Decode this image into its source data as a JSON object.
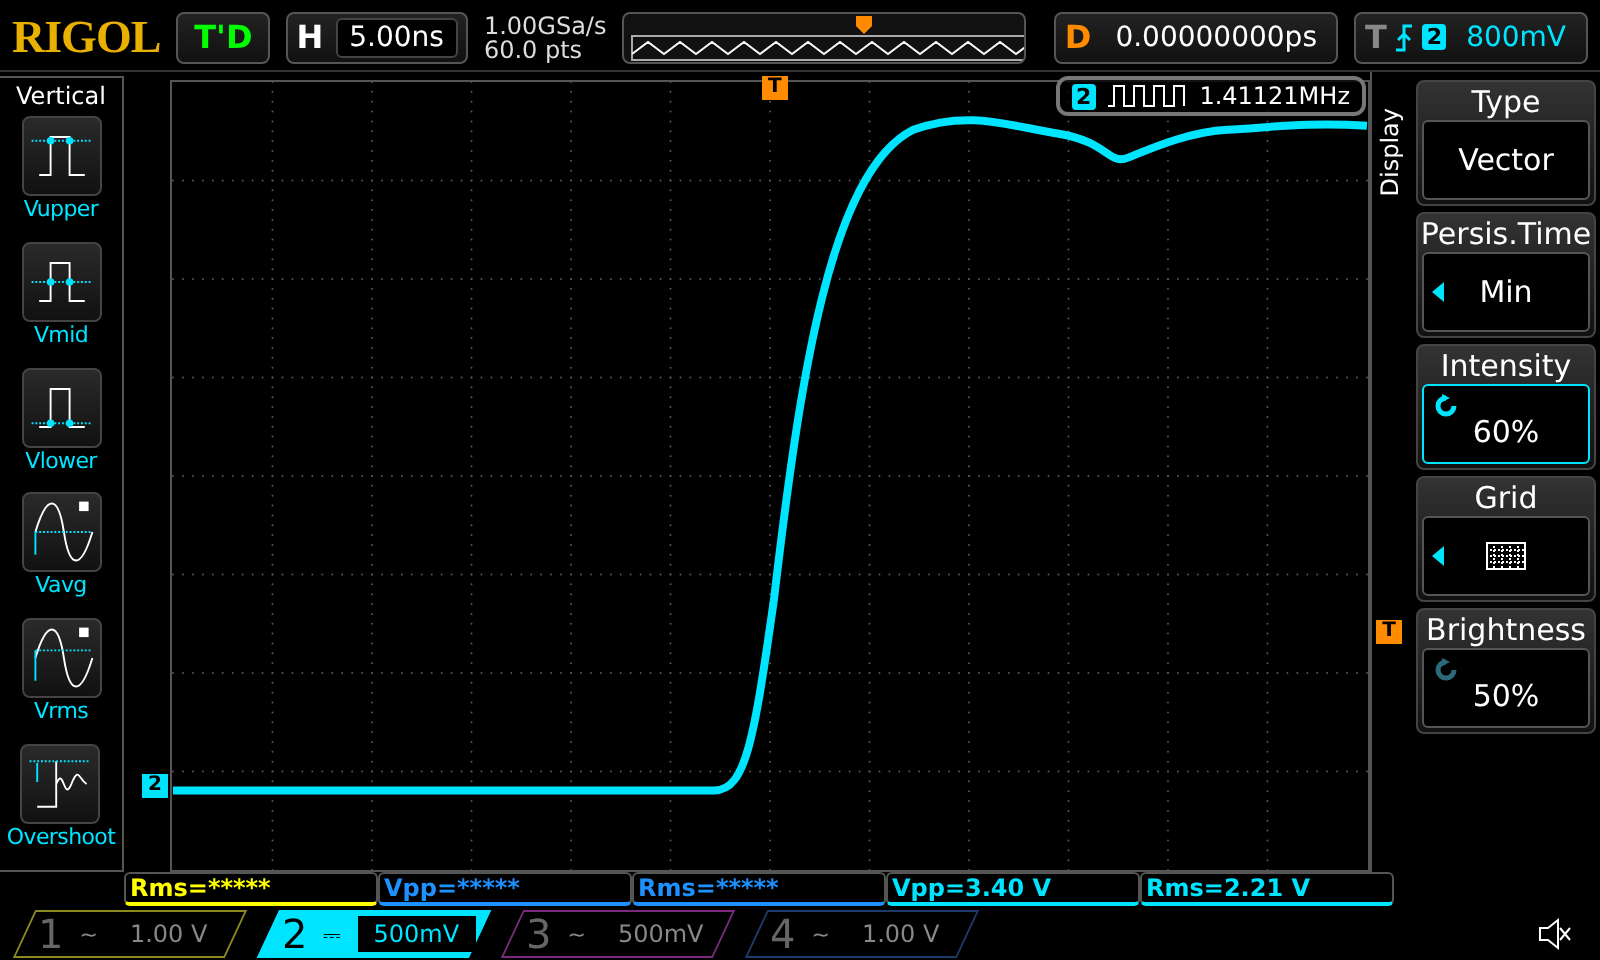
{
  "brand": "RIGOL",
  "status": "T'D",
  "horizontal": {
    "label": "H",
    "value": "5.00ns"
  },
  "acquisition": {
    "sample_rate": "1.00GSa/s",
    "points": "60.0 pts"
  },
  "delay": {
    "label": "D",
    "value": "0.00000000ps"
  },
  "trigger": {
    "label": "T",
    "channel": "2",
    "level": "800mV"
  },
  "left_menu": {
    "title": "Vertical",
    "items": [
      {
        "label": "Vupper",
        "kind": "upper"
      },
      {
        "label": "Vmid",
        "kind": "mid"
      },
      {
        "label": "Vlower",
        "kind": "lower"
      },
      {
        "label": "Vavg",
        "kind": "avg"
      },
      {
        "label": "Vrms",
        "kind": "rms"
      },
      {
        "label": "Overshoot",
        "kind": "overshoot"
      }
    ]
  },
  "scope": {
    "trigger_marker": "T",
    "level_marker": "T",
    "channel_marker": "2",
    "counter": {
      "channel": "2",
      "value": "1.41121MHz"
    }
  },
  "right_menu": {
    "title": "Display",
    "items": [
      {
        "title": "Type",
        "value": "Vector",
        "kind": "text",
        "selected": false
      },
      {
        "title": "Persis.Time",
        "value": "Min",
        "kind": "select",
        "selected": false
      },
      {
        "title": "Intensity",
        "value": "60%",
        "kind": "knob",
        "selected": true
      },
      {
        "title": "Grid",
        "kind": "grid",
        "selected": false
      },
      {
        "title": "Brightness",
        "value": "50%",
        "kind": "knob",
        "selected": false
      }
    ]
  },
  "measurements": [
    {
      "text": "Rms=*****",
      "color": "#ffff00"
    },
    {
      "text": "Vpp=*****",
      "color": "#1e90ff"
    },
    {
      "text": "Rms=*****",
      "color": "#1e90ff"
    },
    {
      "text": "Vpp=3.40 V",
      "color": "#00e5ff"
    },
    {
      "text": "Rms=2.21 V",
      "color": "#00e5ff"
    }
  ],
  "channels": [
    {
      "number": "1",
      "coupling": "~",
      "scale": "1.00 V",
      "selected": false,
      "color": "#8a8a20"
    },
    {
      "number": "2",
      "coupling": "⎓",
      "scale": "500mV",
      "selected": true,
      "color": "#00e5ff"
    },
    {
      "number": "3",
      "coupling": "~",
      "scale": "500mV",
      "selected": false,
      "color": "#7a2a7a"
    },
    {
      "number": "4",
      "coupling": "~",
      "scale": "1.00 V",
      "selected": false,
      "color": "#1e3a6a"
    }
  ]
}
